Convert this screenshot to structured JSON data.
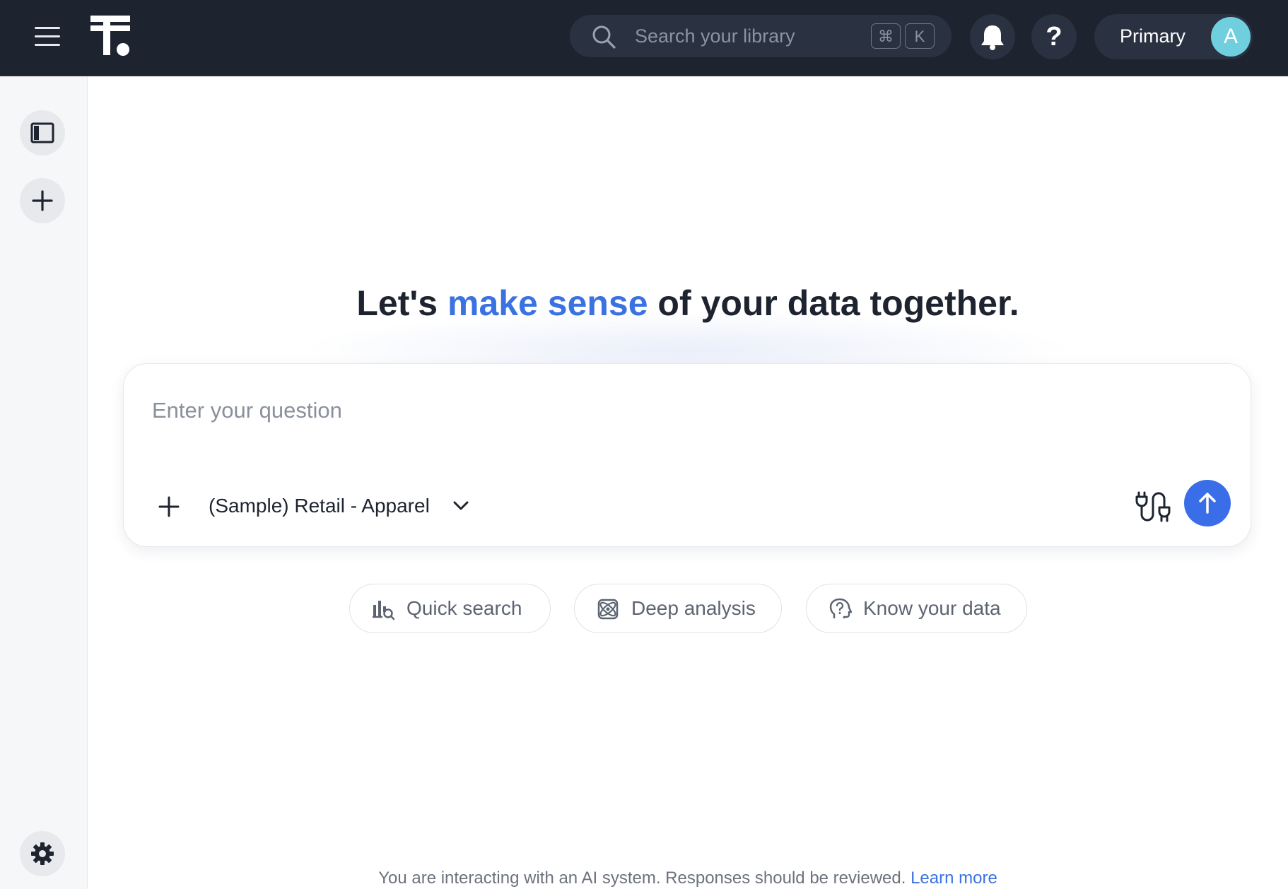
{
  "topbar": {
    "search_placeholder": "Search your library",
    "shortcut_cmd": "⌘",
    "shortcut_key": "K",
    "help_label": "?",
    "account_label": "Primary",
    "avatar_initial": "A"
  },
  "main": {
    "headline_prefix": "Let's ",
    "headline_accent": "make sense",
    "headline_suffix": " of your data together.",
    "question_placeholder": "Enter your question",
    "data_source": "(Sample) Retail - Apparel",
    "modes": [
      {
        "label": "Quick search",
        "icon": "chart-search-icon"
      },
      {
        "label": "Deep analysis",
        "icon": "orbit-analysis-icon"
      },
      {
        "label": "Know your data",
        "icon": "head-question-icon"
      }
    ]
  },
  "footer": {
    "disclaimer": "You are interacting with an AI system. Responses should be reviewed.",
    "link": "Learn more"
  },
  "colors": {
    "topbar_bg": "#1d232f",
    "accent": "#3b72e2",
    "send_button": "#3a6ee8",
    "avatar_bg": "#6fcfdf"
  }
}
